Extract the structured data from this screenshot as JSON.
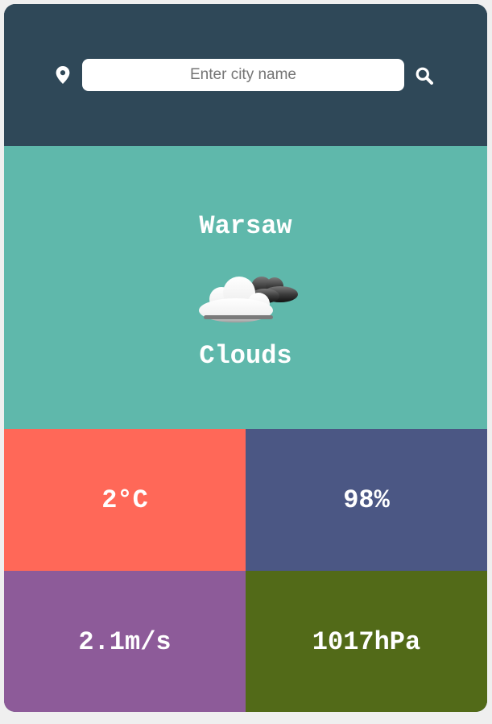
{
  "search": {
    "placeholder": "Enter city name",
    "icon": "search-icon",
    "location_icon": "map-pin-icon"
  },
  "weather": {
    "city": "Warsaw",
    "icon": "clouds-icon",
    "condition": "Clouds"
  },
  "stats": {
    "temperature": "2°C",
    "humidity": "98%",
    "wind": "2.1m/s",
    "pressure": "1017hPa"
  },
  "colors": {
    "header_bg": "#2f4858",
    "main_bg": "#5fb8ab",
    "temperature_bg": "#ff6858",
    "humidity_bg": "#4b5784",
    "wind_bg": "#8d5b99",
    "pressure_bg": "#526a18"
  }
}
